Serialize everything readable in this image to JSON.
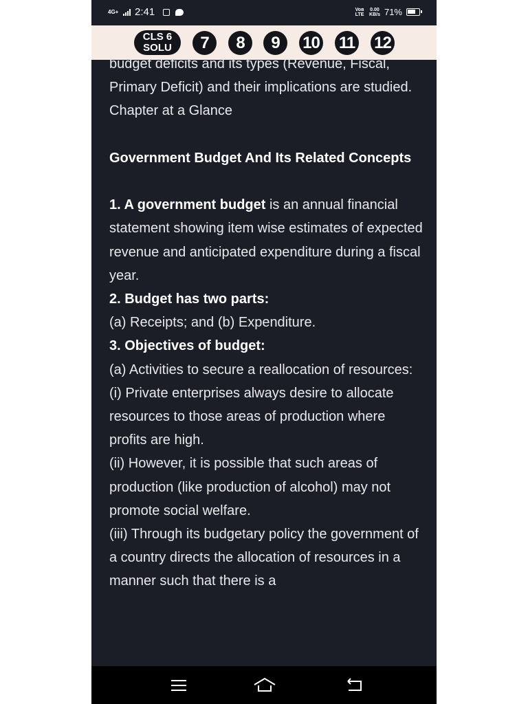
{
  "status_bar": {
    "network": "4G+",
    "time": "2:41",
    "volte": "Voʙ LTE",
    "speed_value": "0.00",
    "speed_unit": "KB/s",
    "battery": "71%",
    "battery_level": 0.71
  },
  "class_nav": {
    "badge_line1": "CLS 6",
    "badge_line2": "SOLU",
    "classes": [
      "7",
      "8",
      "9",
      "10",
      "11",
      "12"
    ]
  },
  "content": {
    "intro_fragment": "budget deficits and its types (Revenue, Fiscal, Primary Deficit) and their implications are studied.",
    "chapter_glance": "Chapter at a Glance",
    "heading": "Government Budget And Its Related Concepts",
    "p1_bold": "1. A government budget",
    "p1_rest": " is an annual financial statement showing item wise estimates of expected revenue and anticipated expenditure during a fiscal year.",
    "p2_bold": "2. Budget has two parts:",
    "p2_rest": "(a) Receipts; and (b) Expenditure.",
    "p3_bold": "3. Objectives of budget:",
    "p3_a": "(a) Activities to secure a reallocation of resources:",
    "p3_i": "(i) Private enterprises always desire to allocate resources to those areas of production where profits are high.",
    "p3_ii": "(ii) However, it is possible that such areas of production (like production of alcohol) may not promote social welfare.",
    "p3_iii": "(iii) Through its budgetary policy the government of a country directs the allocation of resources in a manner such that there is a"
  },
  "bottom_nav": {
    "icons": [
      "menu-icon",
      "home-icon",
      "back-icon"
    ]
  },
  "colors": {
    "background": "#1b1e27",
    "nav_bar": "#f7ebe6",
    "circle": "#13151a",
    "text": "#e9e9ec"
  }
}
